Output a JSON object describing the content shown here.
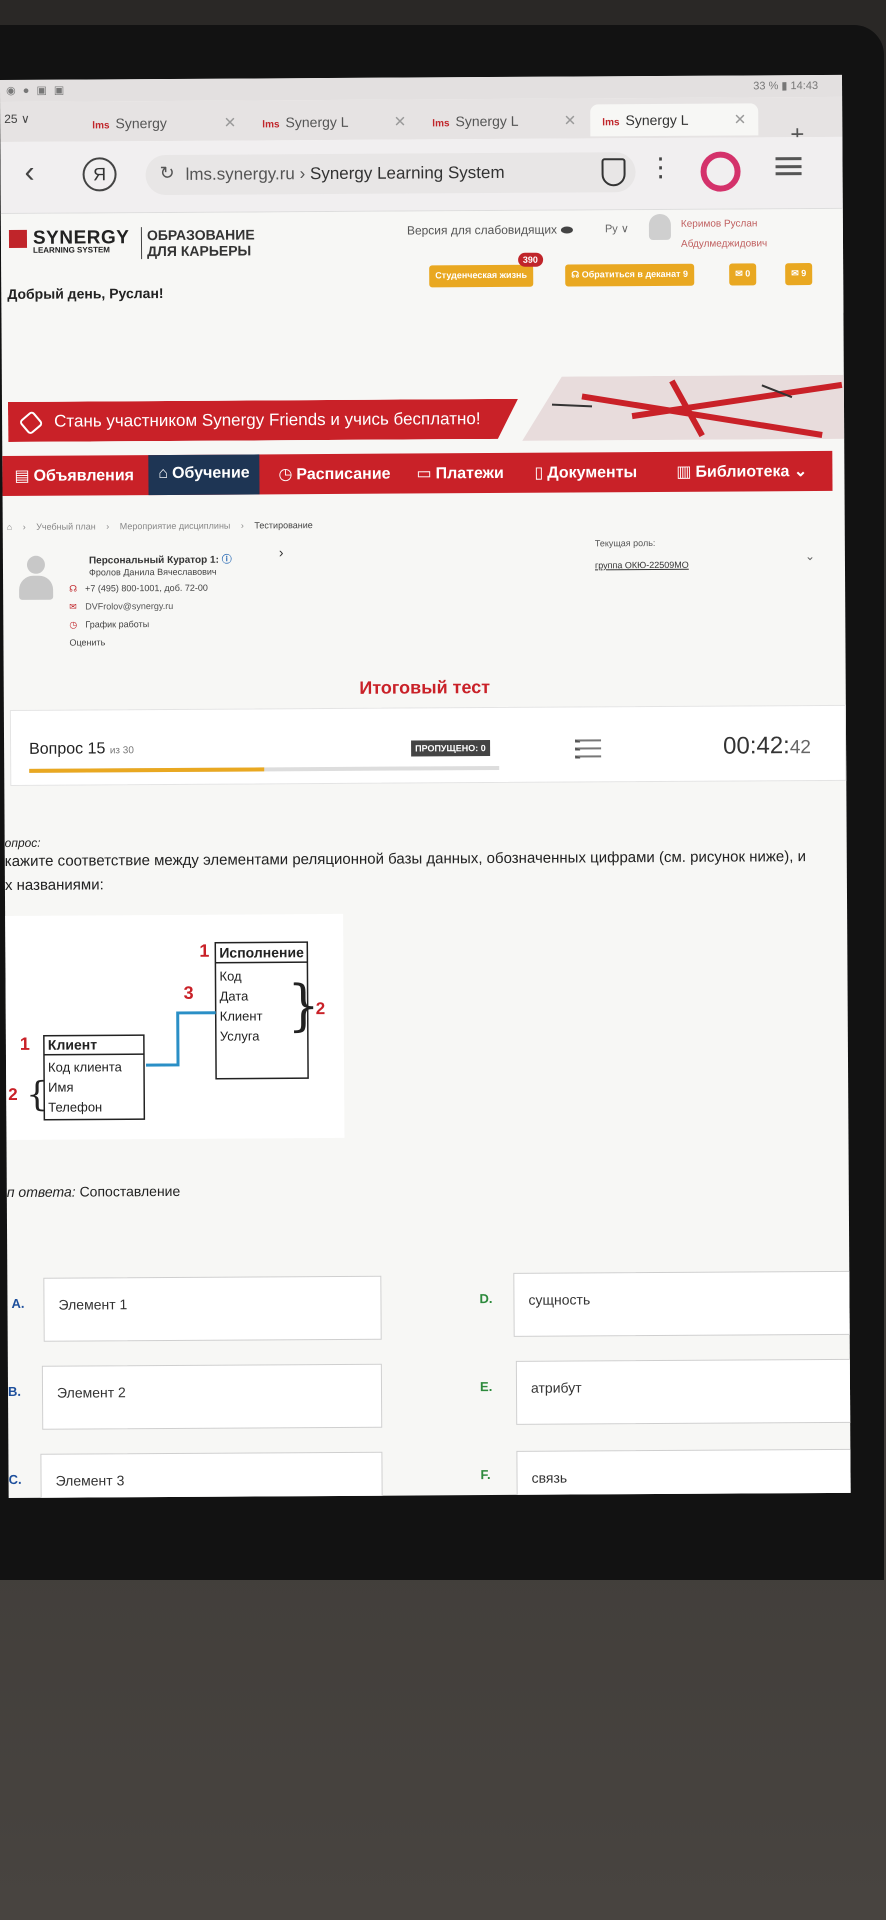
{
  "statusbar": {
    "left_icons": "◉ ● ▣ ▣",
    "right": "33 %  ▮  14:43"
  },
  "tabs": {
    "count": "25 ∨",
    "items": [
      {
        "logo": "lms",
        "label": "Synergy"
      },
      {
        "logo": "lms",
        "label": "Synergy L"
      },
      {
        "logo": "lms",
        "label": "Synergy L"
      },
      {
        "logo": "lms",
        "label": "Synergy L"
      }
    ],
    "new_tab": "+"
  },
  "address": {
    "yandex_letter": "Я",
    "host": "lms.synergy.ru",
    "sep": " › ",
    "title": "Synergy Learning System"
  },
  "site_header": {
    "logo_main": "SYNERGY",
    "logo_sub": "LEARNING SYSTEM",
    "tagline_1": "ОБРАЗОВАНИЕ",
    "tagline_2": "ДЛЯ КАРЬЕРЫ",
    "greeting": "Добрый день, Руслан!",
    "accessibility": "Версия для слабовидящих",
    "lang": "Ру ∨",
    "user_name_1": "Керимов Руслан",
    "user_name_2": "Абдулмеджидович",
    "pills": [
      {
        "label": "Студенческая жизнь",
        "badge": "390"
      },
      {
        "label": "Обратиться в деканат 9"
      },
      {
        "label": "0"
      },
      {
        "label": "9"
      }
    ]
  },
  "promo": {
    "text": "Стань участником Synergy Friends и учись бесплатно!"
  },
  "nav": {
    "items": [
      {
        "icon": "▤",
        "label": "Объявления"
      },
      {
        "icon": "⌂",
        "label": "Обучение"
      },
      {
        "icon": "◷",
        "label": "Расписание"
      },
      {
        "icon": "▭",
        "label": "Платежи"
      },
      {
        "icon": "▯",
        "label": "Документы"
      },
      {
        "icon": "▥",
        "label": "Библиотека ⌄"
      }
    ]
  },
  "breadcrumb": {
    "home": "⌂",
    "items": [
      "Учебный план",
      "Мероприятие дисциплины",
      "Тестирование"
    ]
  },
  "curator": {
    "title": "Персональный Куратор 1:",
    "name": "Фролов Данила Вячеславович",
    "phone": "+7 (495) 800-1001, доб. 72-00",
    "email": "DVFrolov@synergy.ru",
    "schedule": "График работы",
    "rate": "Оценить"
  },
  "role": {
    "label": "Текущая роль:",
    "value": "группа ОКЮ-22509МО"
  },
  "test": {
    "title": "Итоговый тест"
  },
  "question_bar": {
    "label": "Вопрос 15",
    "of": "из 30",
    "progress": 0.5,
    "skipped": "ПРОПУЩЕНО: 0",
    "timer_main": "00:42:",
    "timer_sec": "42"
  },
  "question": {
    "label": "опрос:",
    "line1": "кажите соответствие между элементами реляционной базы данных, обозначенных цифрами (см. рисунок ниже), и",
    "line2": "х названиями:",
    "answer_type_label": "п ответа:",
    "answer_type_value": "Сопоставление"
  },
  "diagram": {
    "table_right": {
      "marker": "1",
      "title": "Исполнение",
      "fields": [
        "Код",
        "Дата",
        "Клиент",
        "Услуга"
      ],
      "brace_marker": "2"
    },
    "table_left": {
      "marker": "1",
      "title": "Клиент",
      "fields": [
        "Код клиента",
        "Имя",
        "Телефон"
      ],
      "brace_marker": "2"
    },
    "link_marker": "3"
  },
  "answers": {
    "left": [
      {
        "letter": "A.",
        "text": "Элемент 1"
      },
      {
        "letter": "B.",
        "text": "Элемент 2"
      },
      {
        "letter": "C.",
        "text": "Элемент 3"
      }
    ],
    "right": [
      {
        "letter": "D.",
        "text": "сущность"
      },
      {
        "letter": "E.",
        "text": "атрибут"
      },
      {
        "letter": "F.",
        "text": "связь"
      }
    ]
  },
  "colors": {
    "brand_red": "#c92128",
    "nav_active": "#1e3554",
    "accent_orange": "#e9a821",
    "answer_blue": "#1d4f9c",
    "answer_green": "#2d8a3c",
    "link_blue": "#2a8fc6"
  }
}
